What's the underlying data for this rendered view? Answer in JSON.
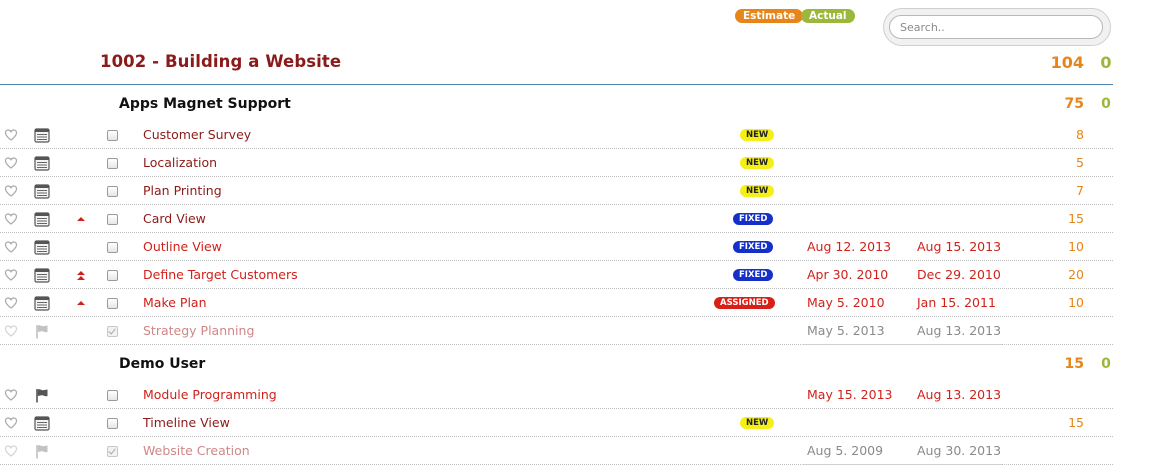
{
  "legend": {
    "estimate": "Estimate",
    "actual": "Actual"
  },
  "search": {
    "placeholder": "Search.."
  },
  "project": {
    "title": "1002 - Building a Website",
    "estimate": "104",
    "actual": "0"
  },
  "colors": {
    "estimate": "#e6861a",
    "actual": "#9cb83c",
    "task": "#8b1a1a",
    "overdue": "#d0211b",
    "new_badge": "#f4ef16",
    "fixed_badge": "#1530c8",
    "assigned_badge": "#d82018",
    "divider": "#4f87b3"
  },
  "groups": [
    {
      "name": "Apps Magnet Support",
      "estimate": "75",
      "actual": "0",
      "tasks": [
        {
          "title": "Customer Survey",
          "status": "normal",
          "icon": "calendar-icon",
          "priority": "",
          "badge": "NEW",
          "start": "",
          "end": "",
          "estimate": "8"
        },
        {
          "title": "Localization",
          "status": "normal",
          "icon": "calendar-icon",
          "priority": "",
          "badge": "NEW",
          "start": "",
          "end": "",
          "estimate": "5"
        },
        {
          "title": "Plan Printing",
          "status": "normal",
          "icon": "calendar-icon",
          "priority": "",
          "badge": "NEW",
          "start": "",
          "end": "",
          "estimate": "7"
        },
        {
          "title": "Card View",
          "status": "normal",
          "icon": "calendar-icon",
          "priority": "high",
          "badge": "FIXED",
          "start": "",
          "end": "",
          "estimate": "15"
        },
        {
          "title": "Outline View",
          "status": "overdue",
          "icon": "calendar-icon",
          "priority": "",
          "badge": "FIXED",
          "start": "Aug 12. 2013",
          "end": "Aug 15. 2013",
          "estimate": "10"
        },
        {
          "title": "Define Target Customers",
          "status": "overdue",
          "icon": "calendar-icon",
          "priority": "highest",
          "badge": "FIXED",
          "start": "Apr 30. 2010",
          "end": "Dec 29. 2010",
          "estimate": "20"
        },
        {
          "title": "Make Plan",
          "status": "overdue",
          "icon": "calendar-icon",
          "priority": "high",
          "badge": "ASSIGNED",
          "start": "May 5. 2010",
          "end": "Jan 15. 2011",
          "estimate": "10"
        },
        {
          "title": "Strategy Planning",
          "status": "done",
          "icon": "flag-icon",
          "priority": "",
          "badge": "",
          "start": "May 5. 2013",
          "end": "Aug 13. 2013",
          "estimate": ""
        }
      ]
    },
    {
      "name": "Demo User",
      "estimate": "15",
      "actual": "0",
      "tasks": [
        {
          "title": "Module Programming",
          "status": "overdue",
          "icon": "flag-icon",
          "priority": "",
          "badge": "",
          "start": "May 15. 2013",
          "end": "Aug 13. 2013",
          "estimate": ""
        },
        {
          "title": "Timeline View",
          "status": "normal",
          "icon": "calendar-icon",
          "priority": "",
          "badge": "NEW",
          "start": "",
          "end": "",
          "estimate": "15"
        },
        {
          "title": "Website Creation",
          "status": "done",
          "icon": "flag-icon",
          "priority": "",
          "badge": "",
          "start": "Aug 5. 2009",
          "end": "Aug 30. 2013",
          "estimate": ""
        }
      ]
    }
  ]
}
